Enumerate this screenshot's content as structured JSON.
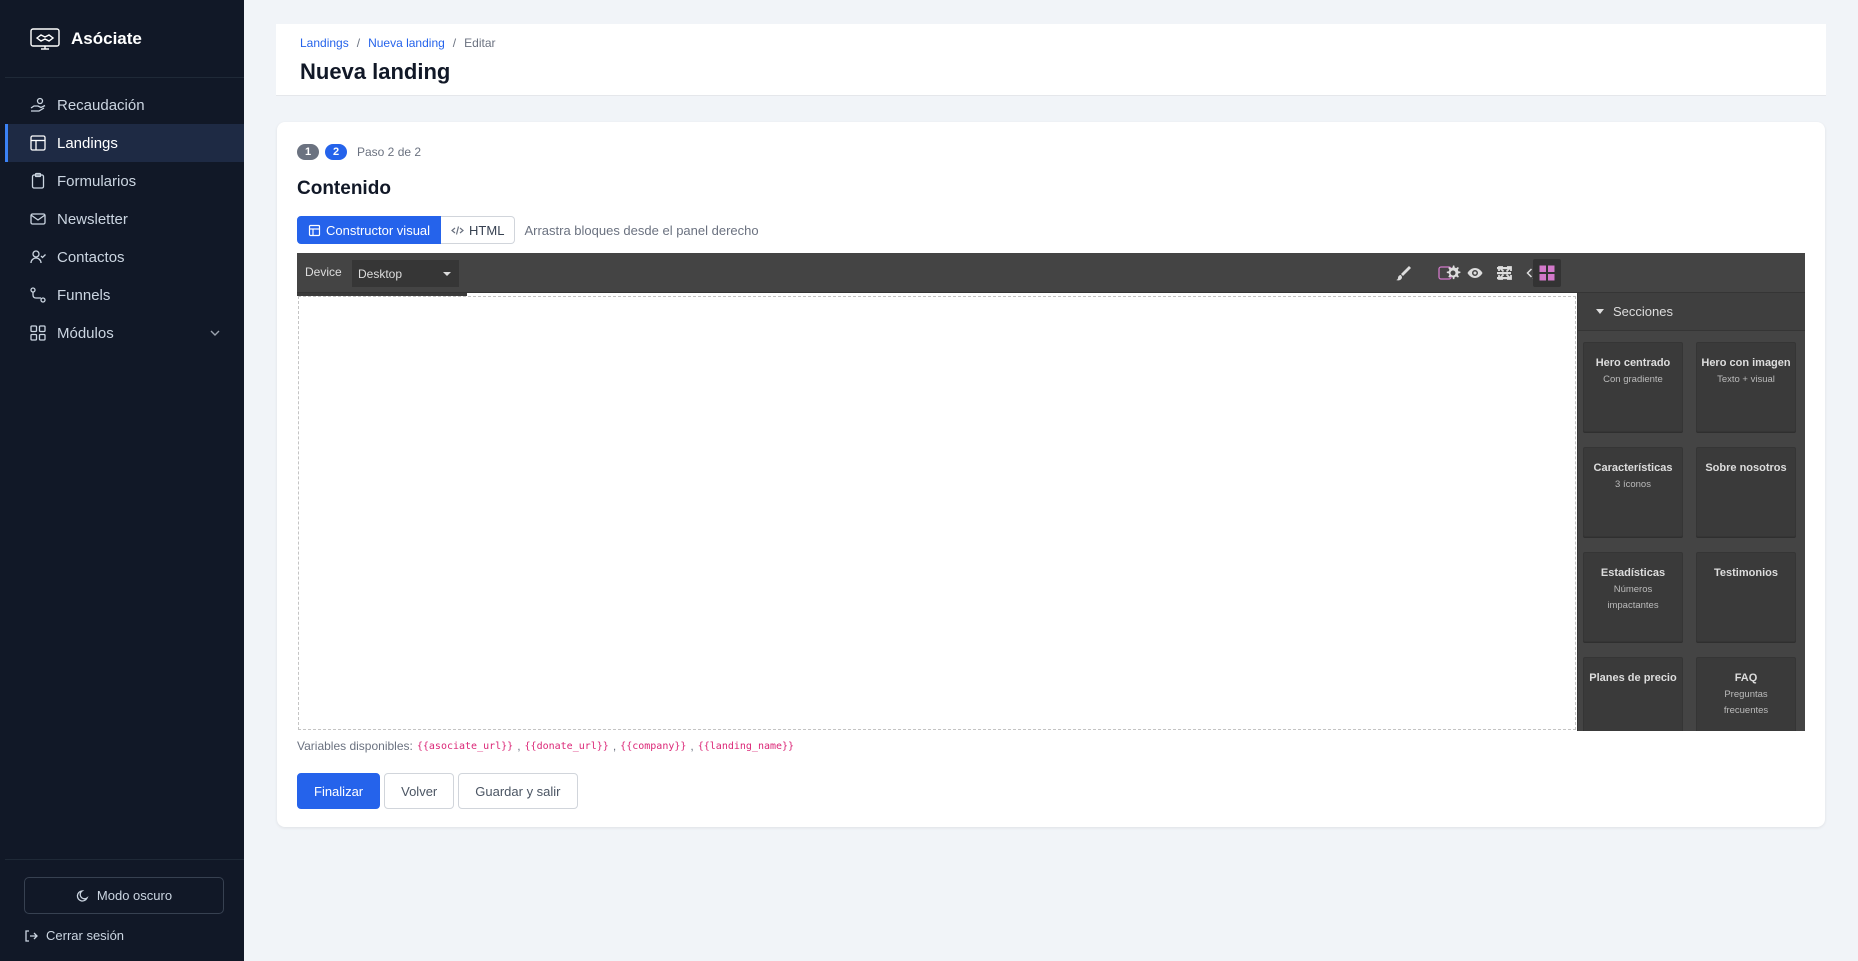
{
  "app": {
    "name": "Asóciate"
  },
  "sidebar": {
    "items": [
      {
        "label": "Recaudación",
        "icon": "hand-coins-icon"
      },
      {
        "label": "Landings",
        "icon": "layout-icon",
        "active": true
      },
      {
        "label": "Formularios",
        "icon": "clipboard-icon"
      },
      {
        "label": "Newsletter",
        "icon": "mail-icon"
      },
      {
        "label": "Contactos",
        "icon": "user-check-icon"
      },
      {
        "label": "Funnels",
        "icon": "route-icon"
      },
      {
        "label": "Módulos",
        "icon": "grid-icon",
        "expandable": true
      }
    ],
    "dark_mode_label": "Modo oscuro",
    "logout_label": "Cerrar sesión"
  },
  "header": {
    "breadcrumb": [
      "Landings",
      "Nueva landing",
      "Editar"
    ],
    "title": "Nueva landing"
  },
  "wizard": {
    "steps": [
      "1",
      "2"
    ],
    "step_text": "Paso 2 de 2",
    "section_title": "Contenido",
    "mode_visual": "Constructor visual",
    "mode_html": "HTML",
    "mode_hint": "Arrastra bloques desde el panel derecho"
  },
  "editor": {
    "device_label": "Device",
    "device_value": "Desktop",
    "panel_title": "Secciones",
    "blocks": [
      {
        "title": "Hero centrado",
        "subtitle": "Con gradiente"
      },
      {
        "title": "Hero con imagen",
        "subtitle": "Texto + visual"
      },
      {
        "title": "Características",
        "subtitle": "3 íconos"
      },
      {
        "title": "Sobre nosotros",
        "subtitle": ""
      },
      {
        "title": "Estadísticas",
        "subtitle": "Números impactantes"
      },
      {
        "title": "Testimonios",
        "subtitle": ""
      },
      {
        "title": "Planes de precio",
        "subtitle": ""
      },
      {
        "title": "FAQ",
        "subtitle": "Preguntas frecuentes"
      }
    ],
    "accent_color": "#d278c9"
  },
  "variables": {
    "label": "Variables disponibles:",
    "items": [
      "{{asociate_url}}",
      "{{donate_url}}",
      "{{company}}",
      "{{landing_name}}"
    ]
  },
  "actions": {
    "finish": "Finalizar",
    "back": "Volver",
    "save_exit": "Guardar y salir"
  },
  "colors": {
    "sidebar_bg": "#111827",
    "primary": "#2563eb",
    "editor_bg": "#444444",
    "variable_text": "#db2777"
  }
}
